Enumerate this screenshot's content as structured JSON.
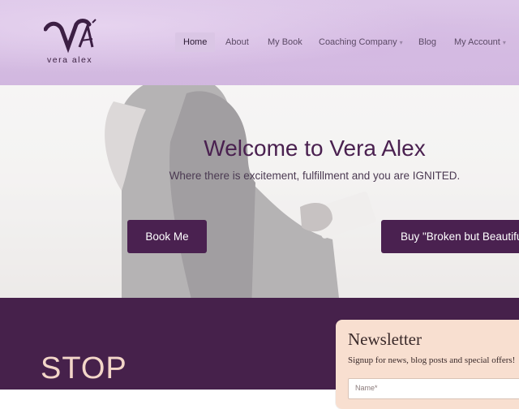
{
  "brand": {
    "logo_text": "vera  alex"
  },
  "nav": {
    "items": [
      {
        "label": "Home"
      },
      {
        "label": "About"
      },
      {
        "label": "My Book"
      },
      {
        "label": "Coaching Company"
      },
      {
        "label": "Blog"
      },
      {
        "label": "My Account"
      }
    ]
  },
  "hero": {
    "title": "Welcome to Vera Alex",
    "subtitle": "Where there is excitement, fulfillment and you are IGNITED.",
    "book_button": "Book Me",
    "buy_button": "Buy \"Broken but Beautiful"
  },
  "section": {
    "stop_heading": "STOP"
  },
  "newsletter": {
    "title": "Newsletter",
    "description": "Signup for news, blog posts and special offers!",
    "name_placeholder": "Name*"
  },
  "colors": {
    "brand_purple": "#46214b",
    "accent_peach": "#f3d6c8",
    "newsletter_bg": "#f8dfd0"
  }
}
